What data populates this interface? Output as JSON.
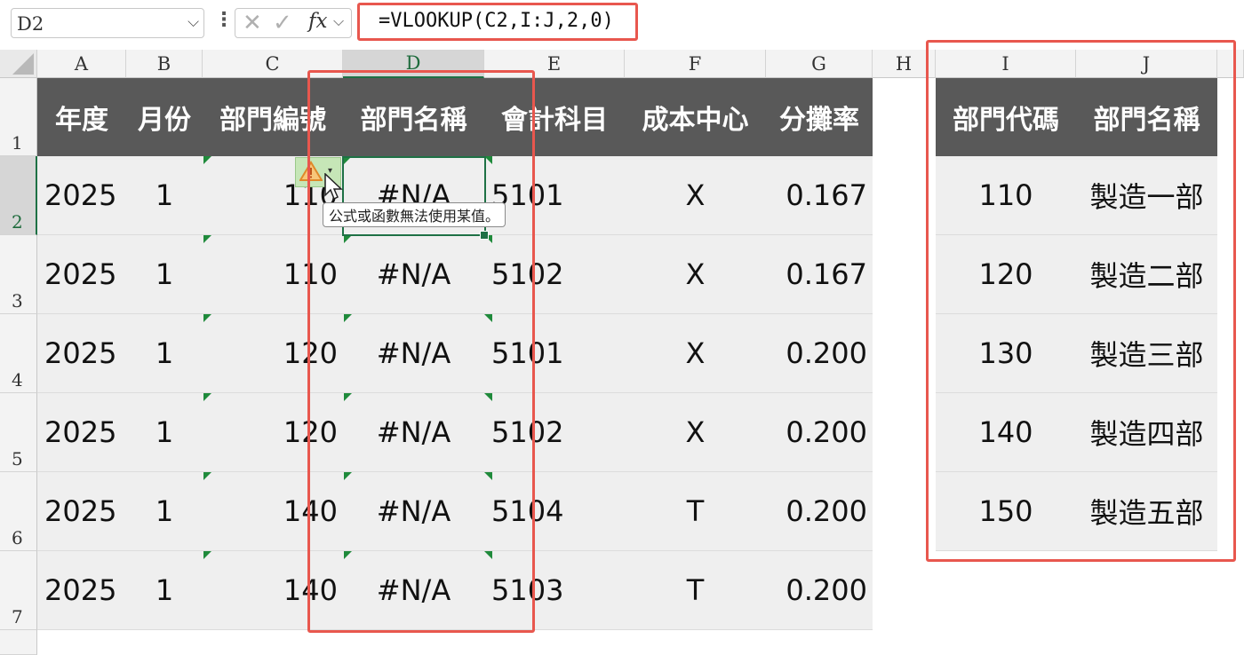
{
  "formula_bar": {
    "name_box": "D2",
    "name_box_dropdown": "⌵",
    "options_dots": "⋮",
    "cancel_glyph": "✕",
    "enter_glyph": "✓",
    "fx_label": "fx",
    "fx_dropdown": "⌵",
    "formula": "=VLOOKUP(C2,I:J,2,0)"
  },
  "columns": [
    "A",
    "B",
    "C",
    "D",
    "E",
    "F",
    "G",
    "H",
    "I",
    "J"
  ],
  "rows": [
    "1",
    "2",
    "3",
    "4",
    "5",
    "6",
    "7"
  ],
  "main_table": {
    "headers": [
      "年度",
      "月份",
      "部門編號",
      "部門名稱",
      "會計科目",
      "成本中心",
      "分攤率"
    ],
    "rows": [
      [
        "2025",
        "1",
        "110",
        "#N/A",
        "5101",
        "X",
        "0.167"
      ],
      [
        "2025",
        "1",
        "110",
        "#N/A",
        "5102",
        "X",
        "0.167"
      ],
      [
        "2025",
        "1",
        "120",
        "#N/A",
        "5101",
        "X",
        "0.200"
      ],
      [
        "2025",
        "1",
        "120",
        "#N/A",
        "5102",
        "X",
        "0.200"
      ],
      [
        "2025",
        "1",
        "140",
        "#N/A",
        "5104",
        "T",
        "0.200"
      ],
      [
        "2025",
        "1",
        "140",
        "#N/A",
        "5103",
        "T",
        "0.200"
      ]
    ]
  },
  "lookup_table": {
    "headers": [
      "部門代碼",
      "部門名稱"
    ],
    "rows": [
      [
        "110",
        "製造一部"
      ],
      [
        "120",
        "製造二部"
      ],
      [
        "130",
        "製造三部"
      ],
      [
        "140",
        "製造四部"
      ],
      [
        "150",
        "製造五部"
      ]
    ]
  },
  "error_indicator": {
    "icon": "warning-triangle",
    "dropdown": "▾",
    "tooltip": "公式或函數無法使用某值。"
  },
  "colors": {
    "header_fill": "#595959",
    "data_fill": "#efefef",
    "selection": "#1e7145",
    "highlight": "#e8574e",
    "error_triangle": "#1f8a3b"
  }
}
